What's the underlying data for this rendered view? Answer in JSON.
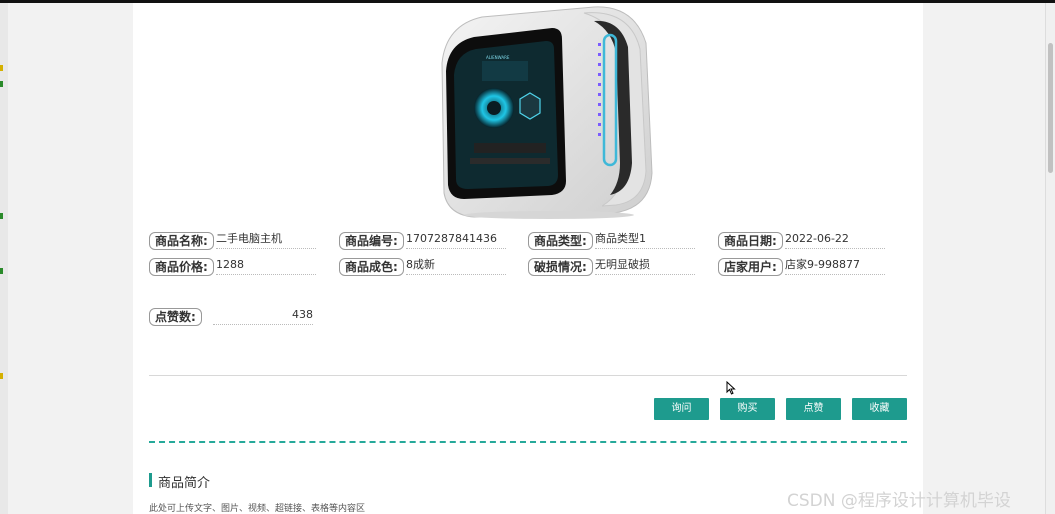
{
  "product": {
    "fields": [
      {
        "label": "商品名称:",
        "value": "二手电脑主机"
      },
      {
        "label": "商品编号:",
        "value": "1707287841436"
      },
      {
        "label": "商品类型:",
        "value": "商品类型1"
      },
      {
        "label": "商品日期:",
        "value": "2022-06-22"
      },
      {
        "label": "商品价格:",
        "value": "1288"
      },
      {
        "label": "商品成色:",
        "value": "8成新"
      },
      {
        "label": "破损情况:",
        "value": "无明显破损"
      },
      {
        "label": "店家用户:",
        "value": "店家9-998877"
      }
    ],
    "likes": {
      "label": "点赞数:",
      "value": "438"
    },
    "image_brand_text": "ALIENWARE"
  },
  "actions": {
    "ask": "询问",
    "buy": "购买",
    "like": "点赞",
    "favorite": "收藏"
  },
  "intro": {
    "title": "商品简介",
    "placeholder": "此处可上传文字、图片、视频、超链接、表格等内容区"
  },
  "watermark": "CSDN @程序设计计算机毕设",
  "colors": {
    "accent": "#1e9b8e",
    "dashed_divider": "#26a99a"
  }
}
